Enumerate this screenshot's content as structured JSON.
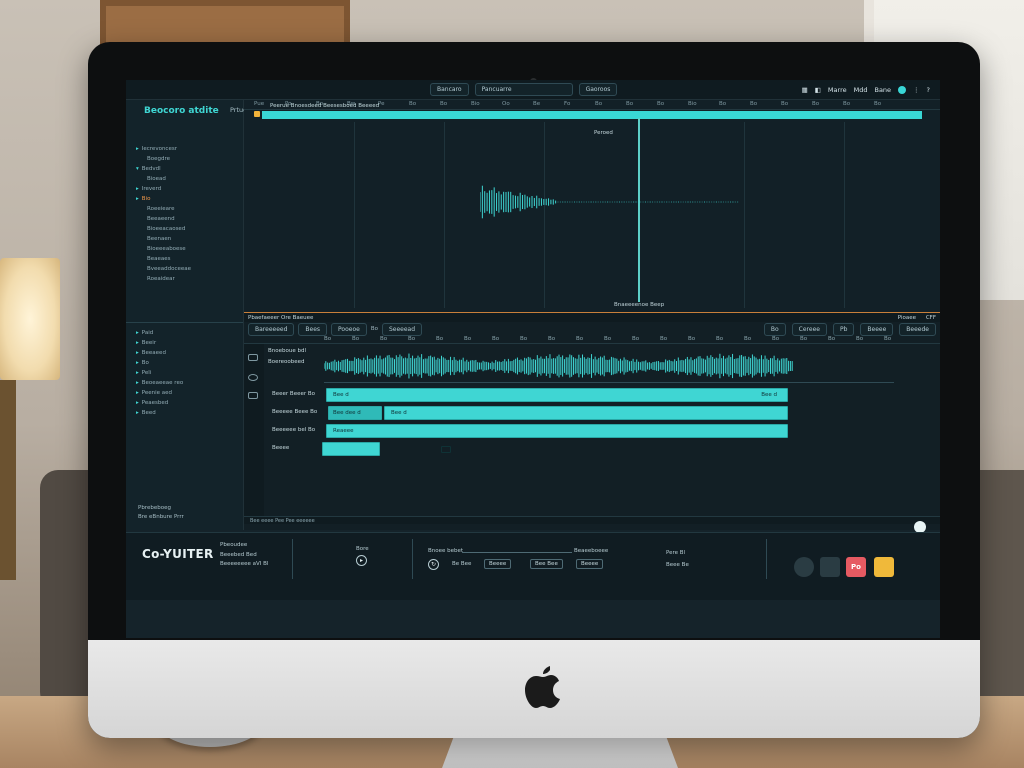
{
  "topbar": {
    "selector_left": "Bancaro",
    "selector_center": "Pancuarre",
    "mode_button": "Gaoroos",
    "right_items": [
      "Marre",
      "Mdd",
      "Bane"
    ]
  },
  "sidebar": {
    "brand": "Beocoro atdite",
    "subtitle": "Prtuenues",
    "tree": [
      {
        "label": "Iecrevoncesr",
        "marker": "▸",
        "hl": false
      },
      {
        "label": "Boegdre",
        "marker": "",
        "hl": false
      },
      {
        "label": "Bedvdl",
        "marker": "▾",
        "hl": false
      },
      {
        "label": "Bioead",
        "marker": "",
        "hl": false
      },
      {
        "label": "Ireverd",
        "marker": "▸",
        "hl": false
      },
      {
        "label": "Bio",
        "marker": "▸",
        "hl": true
      },
      {
        "label": "Roeeieare",
        "marker": "",
        "hl": false
      },
      {
        "label": "Beeaeend",
        "marker": "",
        "hl": false
      },
      {
        "label": "Bioeeacaosed",
        "marker": "",
        "hl": false
      },
      {
        "label": "Beenaen",
        "marker": "",
        "hl": false
      },
      {
        "label": "Bioeeeaboese",
        "marker": "",
        "hl": false
      },
      {
        "label": "Beaeaes",
        "marker": "",
        "hl": false
      },
      {
        "label": "Bveeaddoceeae",
        "marker": "",
        "hl": false
      },
      {
        "label": "Roeaidear",
        "marker": "",
        "hl": false
      }
    ],
    "tree2": [
      {
        "label": "Paid"
      },
      {
        "label": "Beeir"
      },
      {
        "label": "Beeaeed"
      },
      {
        "label": "Bo"
      },
      {
        "label": "Peli"
      },
      {
        "label": "Beoeaeeae reo"
      },
      {
        "label": "Peenie aed"
      },
      {
        "label": "Peaesbed"
      },
      {
        "label": "Beed"
      }
    ],
    "footer_line1": "Pbrebeboeg",
    "footer_line2": "Bre eBnbure Prrr"
  },
  "arrange": {
    "region_label": "Peerue Bnoesdeed Beesesboed Beeeed",
    "marker_label": "Peroed",
    "section_label": "Bnaeeeenoe Beep",
    "ruler": [
      "Pue",
      "Po",
      "Bo",
      "Bw",
      "Pe",
      "Bo",
      "Bo",
      "Bio",
      "Oo",
      "Be",
      "Fo",
      "Bo",
      "Bo",
      "Bo",
      "Bio",
      "Bo",
      "Bo",
      "Bo",
      "Bo",
      "Bo",
      "Bo"
    ]
  },
  "mixer_bar": {
    "left_label": "Pbaefaeeer Ore Baeuee",
    "right_label": "Pioaee",
    "right_extra": "CFF"
  },
  "editor": {
    "head_items": [
      "Bareeeeed",
      "Bees",
      "Pooeoe",
      "Bo",
      "Seeeead"
    ],
    "ruler": [
      "Bo",
      "Bo",
      "Bo",
      "Bo",
      "Bo",
      "Bo",
      "Bo",
      "Bo",
      "Bo",
      "Bo",
      "Bo",
      "Bo",
      "Bo",
      "Bo",
      "Bo",
      "Bo",
      "Bo",
      "Bo",
      "Bo",
      "Bo",
      "Bo"
    ],
    "right_items": [
      "Bo",
      "Cereee",
      "Pb",
      "Beeee",
      "Beeede"
    ],
    "audio_label": "Bnoeboue bdl",
    "audio_sublabel": "Boereoobeed",
    "tracks": [
      {
        "name": "Beeer Beeer Bo",
        "clip_text": "Bee d",
        "clip_end_text": "Bee d"
      },
      {
        "name": "Beeeee Beee Bo",
        "clip_text": "Bee d",
        "clip_pre_text": "Bee dee d"
      },
      {
        "name": "Beeeeee bel Bo",
        "clip_text": "Reaeee"
      },
      {
        "name": "Beeee",
        "clip_text": ""
      }
    ],
    "scroll_label": "Bee eeee Pee Pee eeeeee"
  },
  "transport": {
    "logo": "Co-YUITER",
    "info_line1": "Pbeoudee",
    "info_line2": "Beeebed Bed",
    "info_line3": "Beeeeeeee aVI Bl",
    "play_label": "Bore",
    "mode_label": "Bnoee bebet",
    "mode_label2": "Beaeeboeee",
    "loop_btn": "Be Bee",
    "sync_btn": "Beeee",
    "tempo_btn": "Bee Bee",
    "bpm_label": "Pere Bl",
    "bpm_label2": "Beee Be",
    "corner_buttons": [
      {
        "label": "",
        "color": "#2a3c43"
      },
      {
        "label": "",
        "color": "#2a3c43"
      },
      {
        "label": "Po",
        "color": "#e65a62"
      },
      {
        "label": "",
        "color": "#f0b93a"
      }
    ]
  },
  "colors": {
    "accent": "#39d7d6",
    "record": "#e65a62",
    "warn": "#f0b93a",
    "bg": "#15232a"
  }
}
